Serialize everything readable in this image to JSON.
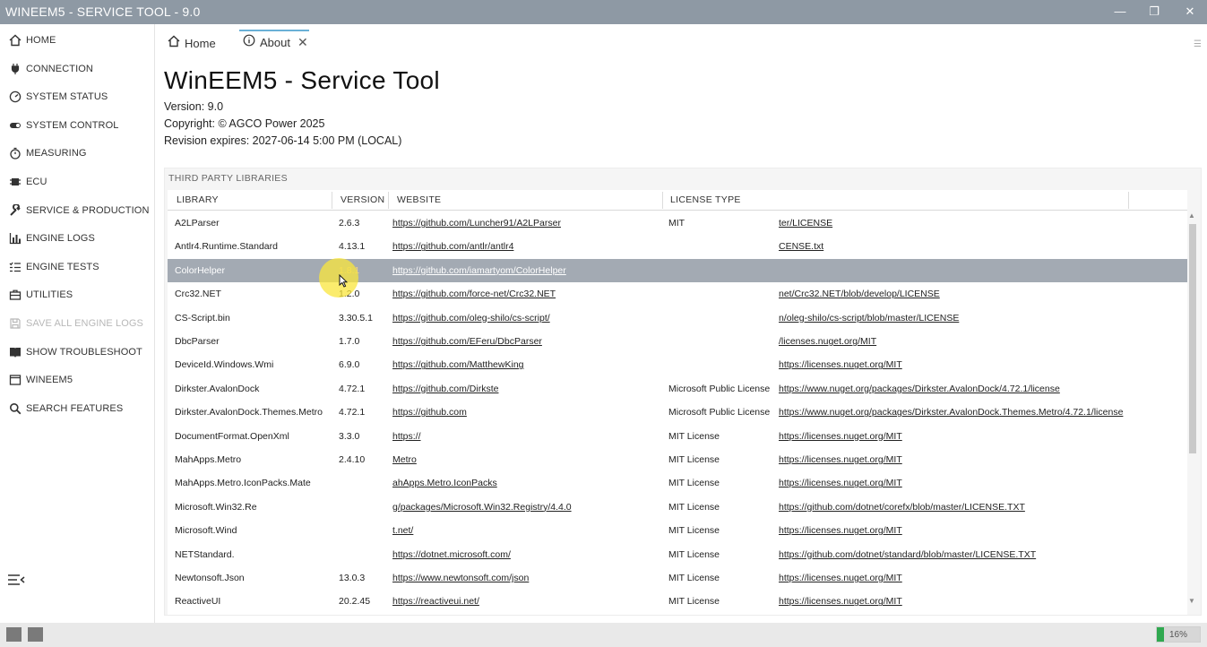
{
  "window": {
    "title": "WINEEM5 - SERVICE TOOL - 9.0"
  },
  "sidebar": {
    "items": [
      {
        "label": "HOME",
        "icon": "home-icon"
      },
      {
        "label": "CONNECTION",
        "icon": "plug-icon"
      },
      {
        "label": "SYSTEM STATUS",
        "icon": "gauge-icon"
      },
      {
        "label": "SYSTEM CONTROL",
        "icon": "toggle-icon"
      },
      {
        "label": "MEASURING",
        "icon": "stopwatch-icon"
      },
      {
        "label": "ECU",
        "icon": "chip-icon"
      },
      {
        "label": "SERVICE & PRODUCTION",
        "icon": "wrench-icon"
      },
      {
        "label": "ENGINE LOGS",
        "icon": "bar-chart-icon"
      },
      {
        "label": "ENGINE TESTS",
        "icon": "checklist-icon"
      },
      {
        "label": "UTILITIES",
        "icon": "briefcase-icon"
      },
      {
        "label": "SAVE ALL ENGINE LOGS",
        "icon": "save-icon",
        "disabled": true
      },
      {
        "label": "SHOW TROUBLESHOOT",
        "icon": "book-icon"
      },
      {
        "label": "WINEEM5",
        "icon": "window-icon"
      },
      {
        "label": "SEARCH FEATURES",
        "icon": "search-icon"
      }
    ]
  },
  "tabs": [
    {
      "label": "Home",
      "icon": "home-icon"
    },
    {
      "label": "About",
      "icon": "info-icon",
      "active": true
    }
  ],
  "about": {
    "title": "WinEEM5 - Service Tool",
    "version": "Version: 9.0",
    "copyright": "Copyright: © AGCO Power 2025",
    "revision": "Revision expires: 2027-06-14 5:00 PM (LOCAL)"
  },
  "libraries": {
    "section_title": "THIRD PARTY LIBRARIES",
    "columns": [
      "LIBRARY",
      "VERSION",
      "WEBSITE",
      "LICENSE TYPE"
    ],
    "selected_index": 2,
    "rows": [
      {
        "library": "A2LParser",
        "version": "2.6.3",
        "website": "https://github.com/Luncher91/A2LParser",
        "license_type": "MIT",
        "license_url": "ter/LICENSE"
      },
      {
        "library": "Antlr4.Runtime.Standard",
        "version": "4.13.1",
        "website": "https://github.com/antlr/antlr4",
        "license_type": "",
        "license_url": "CENSE.txt"
      },
      {
        "library": "ColorHelper",
        "version": "1.8.1",
        "website": "https://github.com/iamartyom/ColorHelper",
        "license_type": "",
        "license_url": ""
      },
      {
        "library": "Crc32.NET",
        "version": "1.2.0",
        "website": "https://github.com/force-net/Crc32.NET",
        "license_type": "",
        "license_url": "net/Crc32.NET/blob/develop/LICENSE"
      },
      {
        "library": "CS-Script.bin",
        "version": "3.30.5.1",
        "website": "https://github.com/oleg-shilo/cs-script/",
        "license_type": "",
        "license_url": "n/oleg-shilo/cs-script/blob/master/LICENSE"
      },
      {
        "library": "DbcParser",
        "version": "1.7.0",
        "website": "https://github.com/EFeru/DbcParser",
        "license_type": "",
        "license_url": "/licenses.nuget.org/MIT"
      },
      {
        "library": "DeviceId.Windows.Wmi",
        "version": "6.9.0",
        "website": "https://github.com/MatthewKing",
        "license_type": "",
        "license_url": "https://licenses.nuget.org/MIT"
      },
      {
        "library": "Dirkster.AvalonDock",
        "version": "4.72.1",
        "website": "https://github.com/Dirkste",
        "license_type": "Microsoft Public License",
        "license_url": "https://www.nuget.org/packages/Dirkster.AvalonDock/4.72.1/license"
      },
      {
        "library": "Dirkster.AvalonDock.Themes.Metro",
        "version": "4.72.1",
        "website": "https://github.com",
        "license_type": "Microsoft Public License",
        "license_url": "https://www.nuget.org/packages/Dirkster.AvalonDock.Themes.Metro/4.72.1/license"
      },
      {
        "library": "DocumentFormat.OpenXml",
        "version": "3.3.0",
        "website": "https://",
        "license_type": "MIT License",
        "license_url": "https://licenses.nuget.org/MIT"
      },
      {
        "library": "MahApps.Metro",
        "version": "2.4.10",
        "website": "Metro",
        "license_type": "MIT License",
        "license_url": "https://licenses.nuget.org/MIT"
      },
      {
        "library": "MahApps.Metro.IconPacks.Mate",
        "version": "",
        "website": "ahApps.Metro.IconPacks",
        "license_type": "MIT License",
        "license_url": "https://licenses.nuget.org/MIT"
      },
      {
        "library": "Microsoft.Win32.Re",
        "version": "",
        "website": "g/packages/Microsoft.Win32.Registry/4.4.0",
        "license_type": "MIT License",
        "license_url": "https://github.com/dotnet/corefx/blob/master/LICENSE.TXT"
      },
      {
        "library": "Microsoft.Wind",
        "version": "",
        "website": "t.net/",
        "license_type": "MIT License",
        "license_url": "https://licenses.nuget.org/MIT"
      },
      {
        "library": "NETStandard.",
        "version": "",
        "website": "https://dotnet.microsoft.com/",
        "license_type": "MIT License",
        "license_url": "https://github.com/dotnet/standard/blob/master/LICENSE.TXT"
      },
      {
        "library": "Newtonsoft.Json",
        "version": "13.0.3",
        "website": "https://www.newtonsoft.com/json",
        "license_type": "MIT License",
        "license_url": "https://licenses.nuget.org/MIT"
      },
      {
        "library": "ReactiveUI",
        "version": "20.2.45",
        "website": "https://reactiveui.net/",
        "license_type": "MIT License",
        "license_url": "https://licenses.nuget.org/MIT"
      }
    ]
  },
  "status": {
    "progress_percent": 16,
    "progress_label": "16%"
  }
}
